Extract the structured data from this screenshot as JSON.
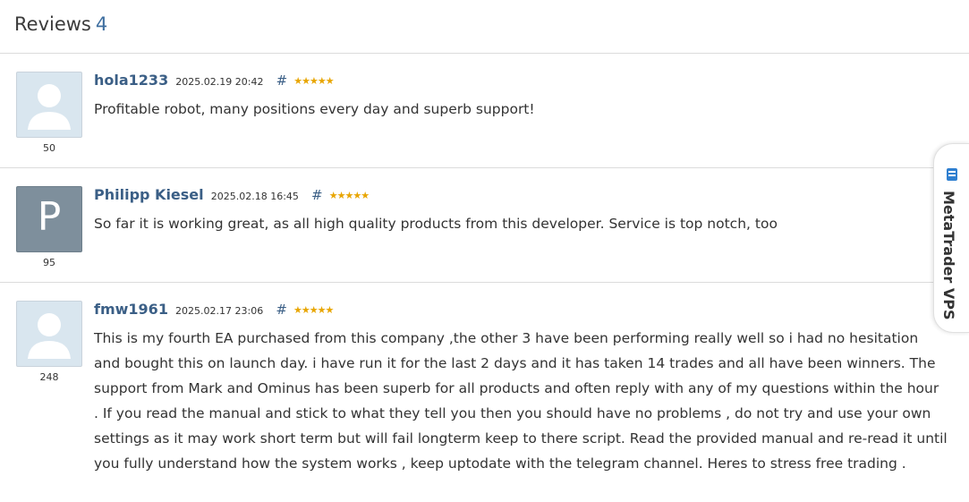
{
  "header": {
    "title": "Reviews",
    "count": "4"
  },
  "reviews": [
    {
      "author": "hola1233",
      "date": "2025.02.19 20:42",
      "hash": "#",
      "rating_count": "50",
      "stars": 5,
      "avatar": "default-avatar",
      "text": "Profitable robot, many positions every day and superb support!"
    },
    {
      "author": "Philipp Kiesel",
      "date": "2025.02.18 16:45",
      "hash": "#",
      "rating_count": "95",
      "stars": 5,
      "avatar_letter": "P",
      "text": "So far it is working great, as all high quality products from this developer. Service is top notch, too"
    },
    {
      "author": "fmw1961",
      "date": "2025.02.17 23:06",
      "hash": "#",
      "rating_count": "248",
      "stars": 5,
      "avatar": "default-avatar",
      "text": "This is my fourth EA purchased from this company ,the other 3 have been performing really well so i had no hesitation and bought this on launch day. i have run it for the last 2 days and it has taken 14 trades and all have been winners. The support from Mark and Ominus has been superb for all products and often reply with any of my questions within the hour . If you read the manual and stick to what they tell you then you should have no problems , do not try and use your own settings as it may work short term but will fail longterm keep to there script. Read the provided manual and re-read it until you fully understand how the system works , keep uptodate with the telegram channel. Heres to stress free trading ."
    }
  ],
  "vps_tab": {
    "label": "MetaTrader VPS",
    "icon": "vps-icon"
  },
  "colors": {
    "link": "#3b5f86",
    "star": "#e8a500",
    "count": "#3f6fa0"
  }
}
